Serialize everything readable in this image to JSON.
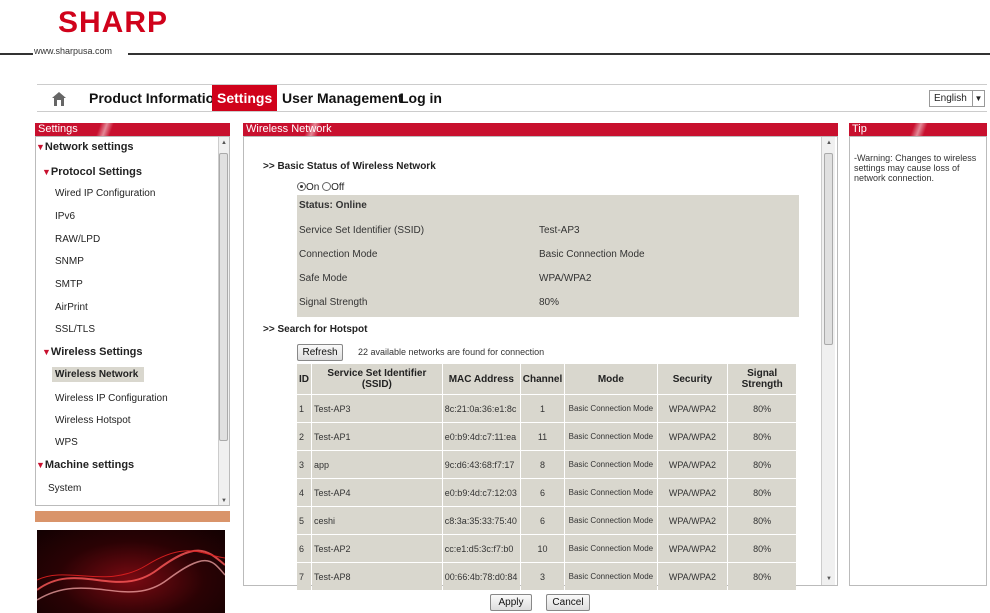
{
  "brand": {
    "logo": "SHARP",
    "url": "www.sharpusa.com",
    "accent": "#c8102e"
  },
  "nav": {
    "items": [
      {
        "label": "Product Information"
      },
      {
        "label": "Settings",
        "active": true
      },
      {
        "label": "User Management"
      },
      {
        "label": "Log in"
      }
    ],
    "language": "English"
  },
  "sidebar": {
    "header": "Settings",
    "items": [
      {
        "label": "Network settings",
        "type": "group"
      },
      {
        "label": "Protocol Settings",
        "type": "subgroup"
      },
      {
        "label": "Wired IP Configuration"
      },
      {
        "label": "IPv6"
      },
      {
        "label": "RAW/LPD"
      },
      {
        "label": "SNMP"
      },
      {
        "label": "SMTP"
      },
      {
        "label": "AirPrint"
      },
      {
        "label": "SSL/TLS"
      },
      {
        "label": "Wireless Settings",
        "type": "subgroup"
      },
      {
        "label": "Wireless Network",
        "active": true
      },
      {
        "label": "Wireless IP Configuration"
      },
      {
        "label": "Wireless Hotspot"
      },
      {
        "label": "WPS"
      },
      {
        "label": "Machine settings",
        "type": "group"
      },
      {
        "label": "System"
      }
    ]
  },
  "main": {
    "header": "Wireless Network",
    "basic_title": ">> Basic Status of Wireless Network",
    "radio": {
      "on": "On",
      "off": "Off",
      "selected": "on"
    },
    "status": "Status: Online",
    "fields": [
      {
        "label": "Service Set Identifier (SSID)",
        "value": "Test-AP3"
      },
      {
        "label": "Connection Mode",
        "value": "Basic Connection Mode"
      },
      {
        "label": "Safe Mode",
        "value": "WPA/WPA2"
      },
      {
        "label": "Signal Strength",
        "value": "80%"
      }
    ],
    "search_title": ">> Search for Hotspot",
    "refresh_label": "Refresh",
    "found_text": "22 available networks are found for connection",
    "columns": [
      "ID",
      "Service Set Identifier (SSID)",
      "MAC Address",
      "Channel",
      "Mode",
      "Security",
      "Signal Strength"
    ],
    "rows": [
      [
        "1",
        "Test-AP3",
        "8c:21:0a:36:e1:8c",
        "1",
        "Basic Connection Mode",
        "WPA/WPA2",
        "80%"
      ],
      [
        "2",
        "Test-AP1",
        "e0:b9:4d:c7:11:ea",
        "11",
        "Basic Connection Mode",
        "WPA/WPA2",
        "80%"
      ],
      [
        "3",
        "app",
        "9c:d6:43:68:f7:17",
        "8",
        "Basic Connection Mode",
        "WPA/WPA2",
        "80%"
      ],
      [
        "4",
        "Test-AP4",
        "e0:b9:4d:c7:12:03",
        "6",
        "Basic Connection Mode",
        "WPA/WPA2",
        "80%"
      ],
      [
        "5",
        "ceshi",
        "c8:3a:35:33:75:40",
        "6",
        "Basic Connection Mode",
        "WPA/WPA2",
        "80%"
      ],
      [
        "6",
        "Test-AP2",
        "cc:e1:d5:3c:f7:b0",
        "10",
        "Basic Connection Mode",
        "WPA/WPA2",
        "80%"
      ],
      [
        "7",
        "Test-AP8",
        "00:66:4b:78:d0:84",
        "3",
        "Basic Connection Mode",
        "WPA/WPA2",
        "80%"
      ]
    ],
    "apply_label": "Apply",
    "cancel_label": "Cancel"
  },
  "tip": {
    "header": "Tip",
    "text": "-Warning: Changes to wireless settings may cause loss of network connection."
  }
}
